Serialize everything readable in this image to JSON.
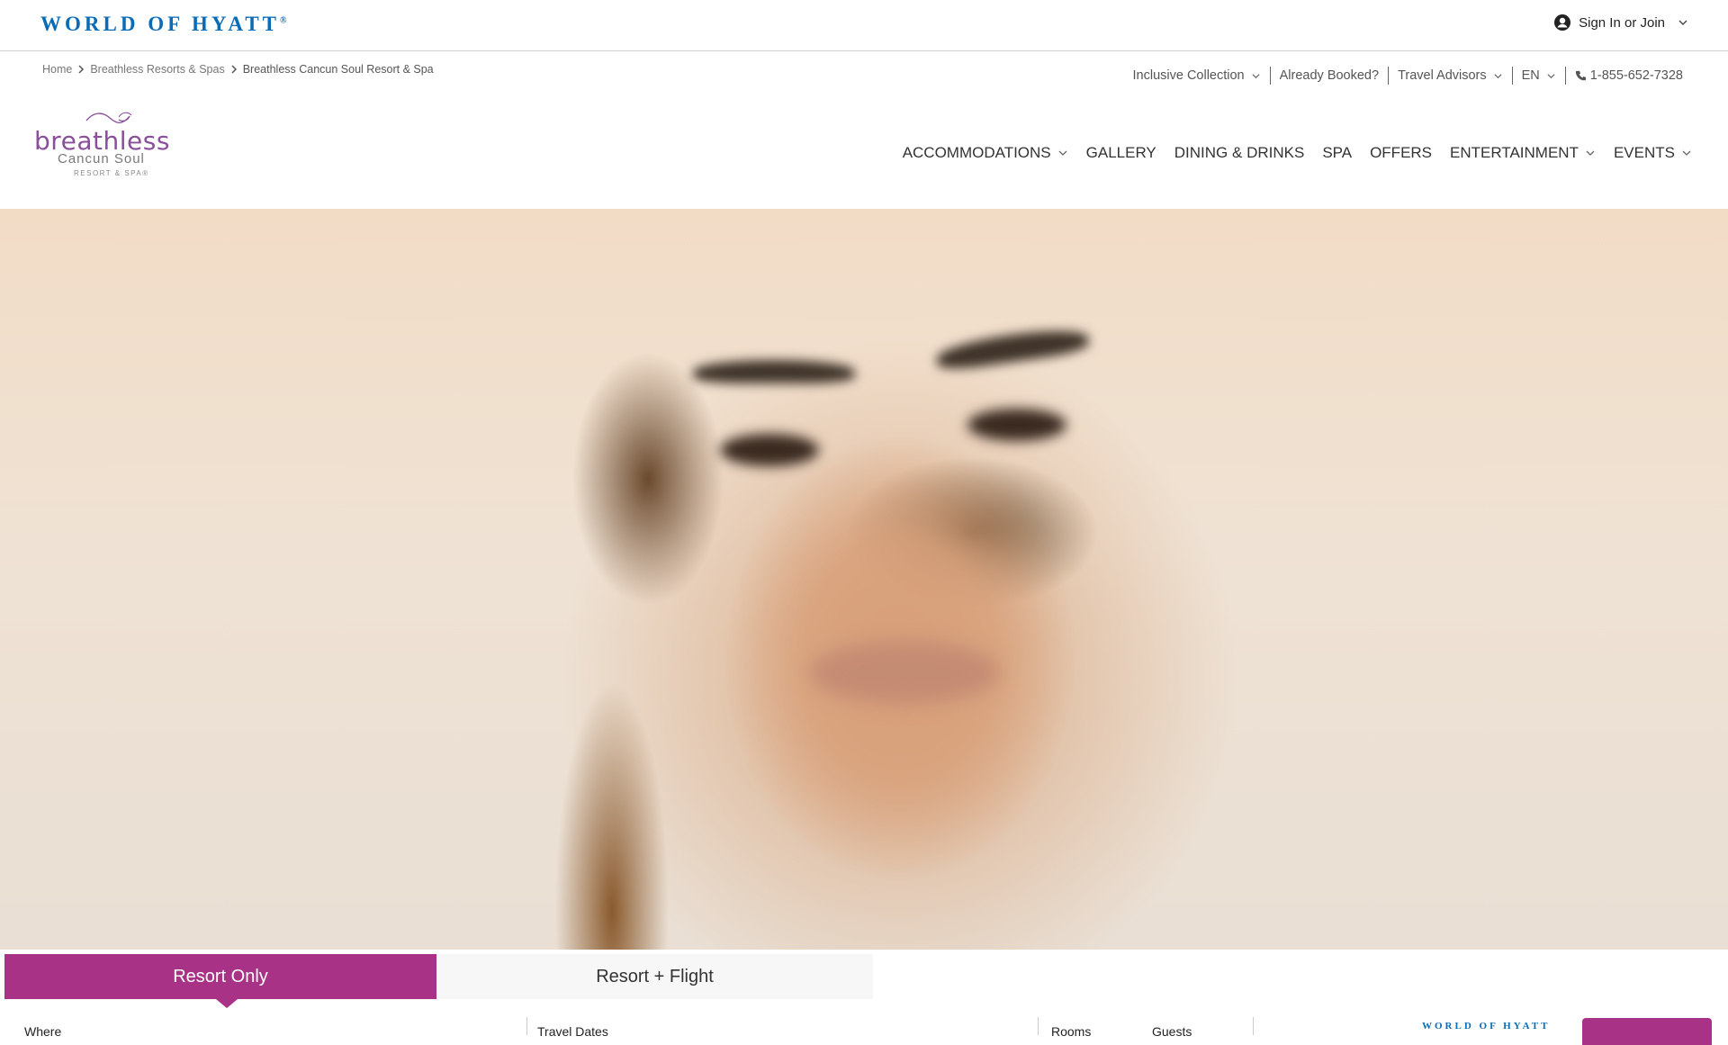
{
  "top_bar": {
    "brand": "WORLD OF HYATT",
    "brand_mark": "®",
    "sign_in": "Sign In or Join"
  },
  "breadcrumb": {
    "items": [
      "Home",
      "Breathless Resorts & Spas",
      "Breathless Cancun Soul Resort & Spa"
    ]
  },
  "utility_nav": {
    "items": [
      {
        "label": "Inclusive Collection",
        "dropdown": true
      },
      {
        "label": "Already Booked?",
        "dropdown": false
      },
      {
        "label": "Travel Advisors",
        "dropdown": true
      },
      {
        "label": "EN",
        "dropdown": true
      },
      {
        "label": "1-855-652-7328",
        "icon": "phone-icon"
      }
    ]
  },
  "resort_brand": {
    "name": "breathless",
    "subtitle": "Cancun Soul",
    "tagline": "RESORT & SPA®"
  },
  "main_nav": {
    "items": [
      {
        "label": "ACCOMMODATIONS",
        "dropdown": true
      },
      {
        "label": "GALLERY",
        "dropdown": false
      },
      {
        "label": "DINING & DRINKS",
        "dropdown": false
      },
      {
        "label": "SPA",
        "dropdown": false
      },
      {
        "label": "OFFERS",
        "dropdown": false
      },
      {
        "label": "ENTERTAINMENT",
        "dropdown": true
      },
      {
        "label": "EVENTS",
        "dropdown": true
      }
    ]
  },
  "booking_tabs": {
    "active": "Resort Only",
    "inactive": "Resort + Flight"
  },
  "booking_form": {
    "where_label": "Where",
    "dates_label": "Travel Dates",
    "rooms_label": "Rooms",
    "guests_label": "Guests",
    "mini_brand": "WORLD OF HYATT"
  },
  "colors": {
    "accent": "#a83386",
    "hyatt_blue": "#0a6cb6"
  }
}
